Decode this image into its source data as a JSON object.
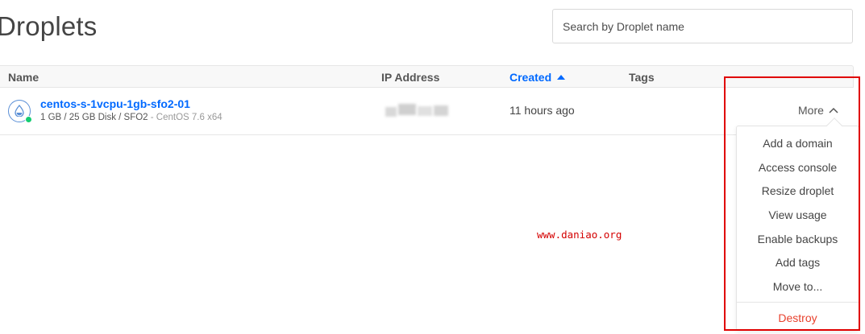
{
  "header": {
    "title": "Droplets",
    "search_placeholder": "Search by Droplet name"
  },
  "table": {
    "columns": {
      "name": "Name",
      "ip": "IP Address",
      "created": "Created",
      "tags": "Tags"
    },
    "sort": {
      "column": "created",
      "direction": "ascending",
      "icon": "sort-up-icon"
    },
    "rows": [
      {
        "name": "centos-s-1vcpu-1gb-sfo2-01",
        "specs": "1 GB / 25 GB Disk / SFO2",
        "os": " - CentOS 7.6 x64",
        "ip": "(blurred)",
        "created": "11 hours ago",
        "tags": "",
        "status": "active",
        "status_color": "#15cd72",
        "more_label": "More"
      }
    ]
  },
  "more_menu": {
    "items": [
      "Add a domain",
      "Access console",
      "Resize droplet",
      "View usage",
      "Enable backups",
      "Add tags",
      "Move to..."
    ],
    "danger_item": "Destroy"
  },
  "watermark": "www.daniao.org",
  "colors": {
    "accent": "#0069ff",
    "danger": "#e8412d",
    "highlight": "#e00000"
  }
}
